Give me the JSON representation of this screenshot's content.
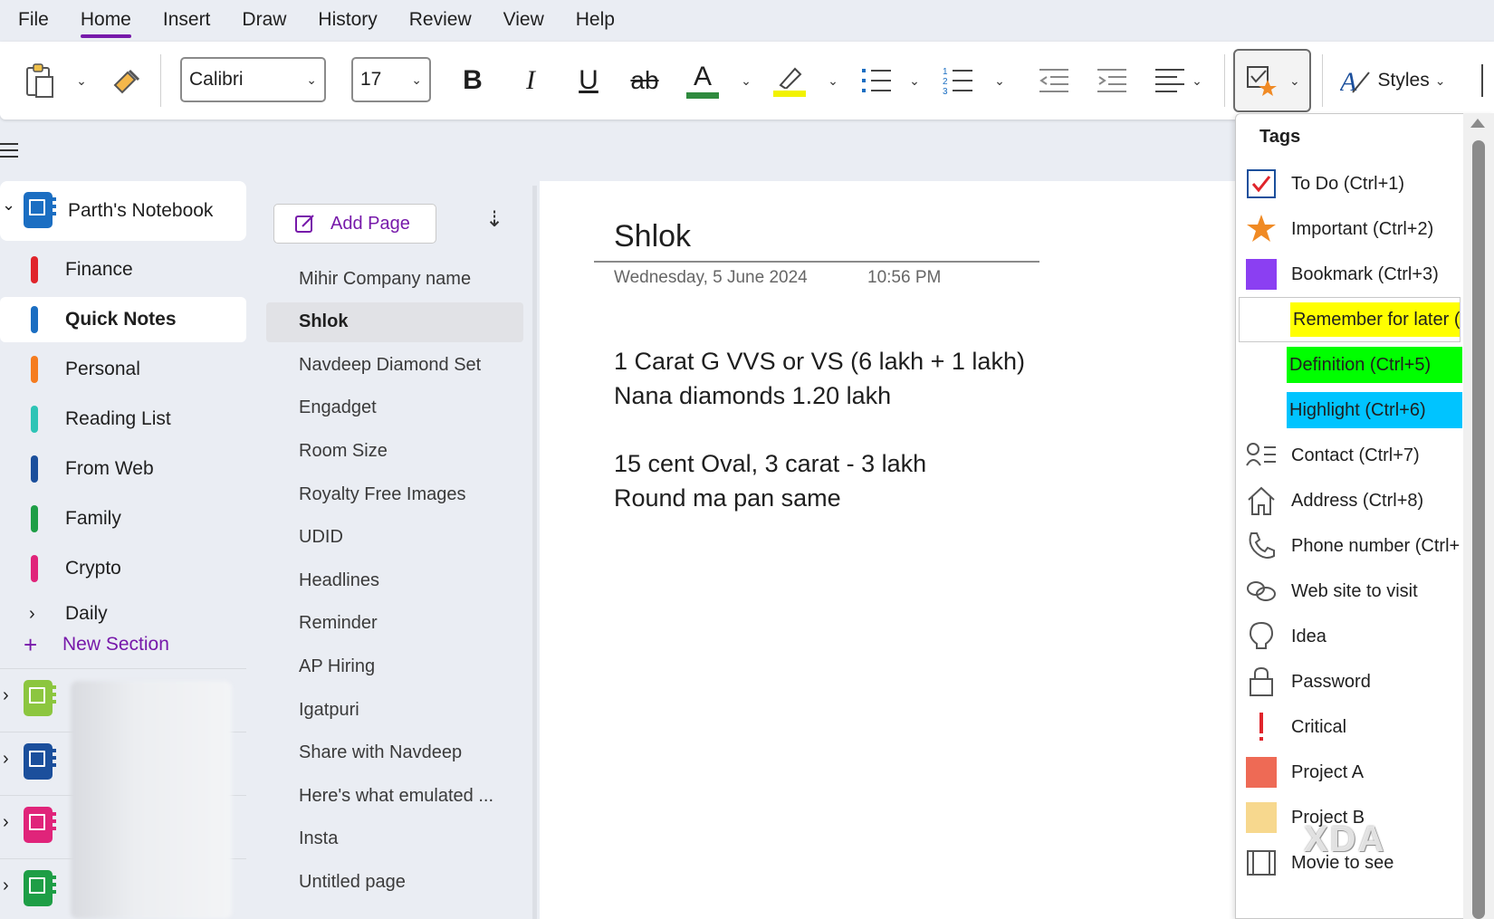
{
  "menu": {
    "items": [
      "File",
      "Home",
      "Insert",
      "Draw",
      "History",
      "Review",
      "View",
      "Help"
    ]
  },
  "ribbon": {
    "font_name": "Calibri",
    "font_size": "17",
    "styles_label": "Styles",
    "icons": [
      "clipboard-paste-icon",
      "format-painter-icon",
      "bold-icon",
      "italic-icon",
      "underline-icon",
      "strikethrough-icon",
      "font-color-icon",
      "highlight-color-icon",
      "bullets-icon",
      "numbering-icon",
      "decrease-indent-icon",
      "increase-indent-icon",
      "align-icon",
      "tag-icon",
      "styles-icon"
    ],
    "font_color": "#2f8a3e",
    "highlight_color": "#f2f200"
  },
  "notebook": {
    "name": "Parth's Notebook",
    "icon_color": "#1b6ec2",
    "sections": [
      {
        "label": "Finance",
        "color": "#e0242b"
      },
      {
        "label": "Quick Notes",
        "color": "#1b6ec2"
      },
      {
        "label": "Personal",
        "color": "#f57c1f"
      },
      {
        "label": "Reading List",
        "color": "#2ec4b6"
      },
      {
        "label": "From Web",
        "color": "#1b4f9c"
      },
      {
        "label": "Family",
        "color": "#1e9e46"
      },
      {
        "label": "Crypto",
        "color": "#e0247a"
      }
    ],
    "daily_label": "Daily",
    "new_section_label": "New Section",
    "other_notebooks": [
      {
        "color": "#8cc63f"
      },
      {
        "color": "#1b4f9c"
      },
      {
        "color": "#e0247a"
      },
      {
        "color": "#1e9e46"
      }
    ]
  },
  "pages": {
    "add_page_label": "Add Page",
    "items": [
      "Mihir Company name",
      "Shlok",
      "Navdeep Diamond Set",
      "Engadget",
      "Room Size",
      "Royalty Free Images",
      "UDID",
      "Headlines",
      "Reminder",
      "AP Hiring",
      "Igatpuri",
      "Share with Navdeep",
      "Here's what emulated ...",
      "Insta",
      "Untitled page"
    ]
  },
  "page": {
    "title": "Shlok",
    "date": "Wednesday, 5 June 2024",
    "time": "10:56 PM",
    "lines": [
      "1 Carat G VVS or VS (6 lakh + 1 lakh)",
      "Nana diamonds 1.20 lakh",
      "15 cent Oval, 3 carat - 3 lakh",
      "Round ma pan same"
    ]
  },
  "tags": {
    "title": "Tags",
    "items": [
      {
        "label": "To Do (Ctrl+1)",
        "icon": "checkbox-icon"
      },
      {
        "label": "Important (Ctrl+2)",
        "icon": "star-icon",
        "color": "#f08a24"
      },
      {
        "label": "Bookmark (Ctrl+3)",
        "icon": "bookmark-square-icon",
        "color": "#8b3ff2"
      },
      {
        "label": "Remember for later (",
        "icon": "none",
        "highlight": "#ffff00"
      },
      {
        "label": "Definition (Ctrl+5)",
        "icon": "none",
        "highlight": "#00ff00"
      },
      {
        "label": "Highlight (Ctrl+6)",
        "icon": "none",
        "highlight": "#00c4ff"
      },
      {
        "label": "Contact (Ctrl+7)",
        "icon": "contact-icon"
      },
      {
        "label": "Address (Ctrl+8)",
        "icon": "home-icon"
      },
      {
        "label": "Phone number (Ctrl+",
        "icon": "phone-icon"
      },
      {
        "label": "Web site to visit",
        "icon": "link-icon"
      },
      {
        "label": "Idea",
        "icon": "lightbulb-icon"
      },
      {
        "label": "Password",
        "icon": "lock-icon"
      },
      {
        "label": "Critical",
        "icon": "exclamation-icon",
        "color": "#e0242b"
      },
      {
        "label": "Project A",
        "icon": "project-a-square-icon",
        "color": "#ee6a55"
      },
      {
        "label": "Project B",
        "icon": "project-b-square-icon",
        "color": "#f7d88e"
      },
      {
        "label": "Movie to see",
        "icon": "film-icon"
      }
    ]
  },
  "watermark": "XDA"
}
